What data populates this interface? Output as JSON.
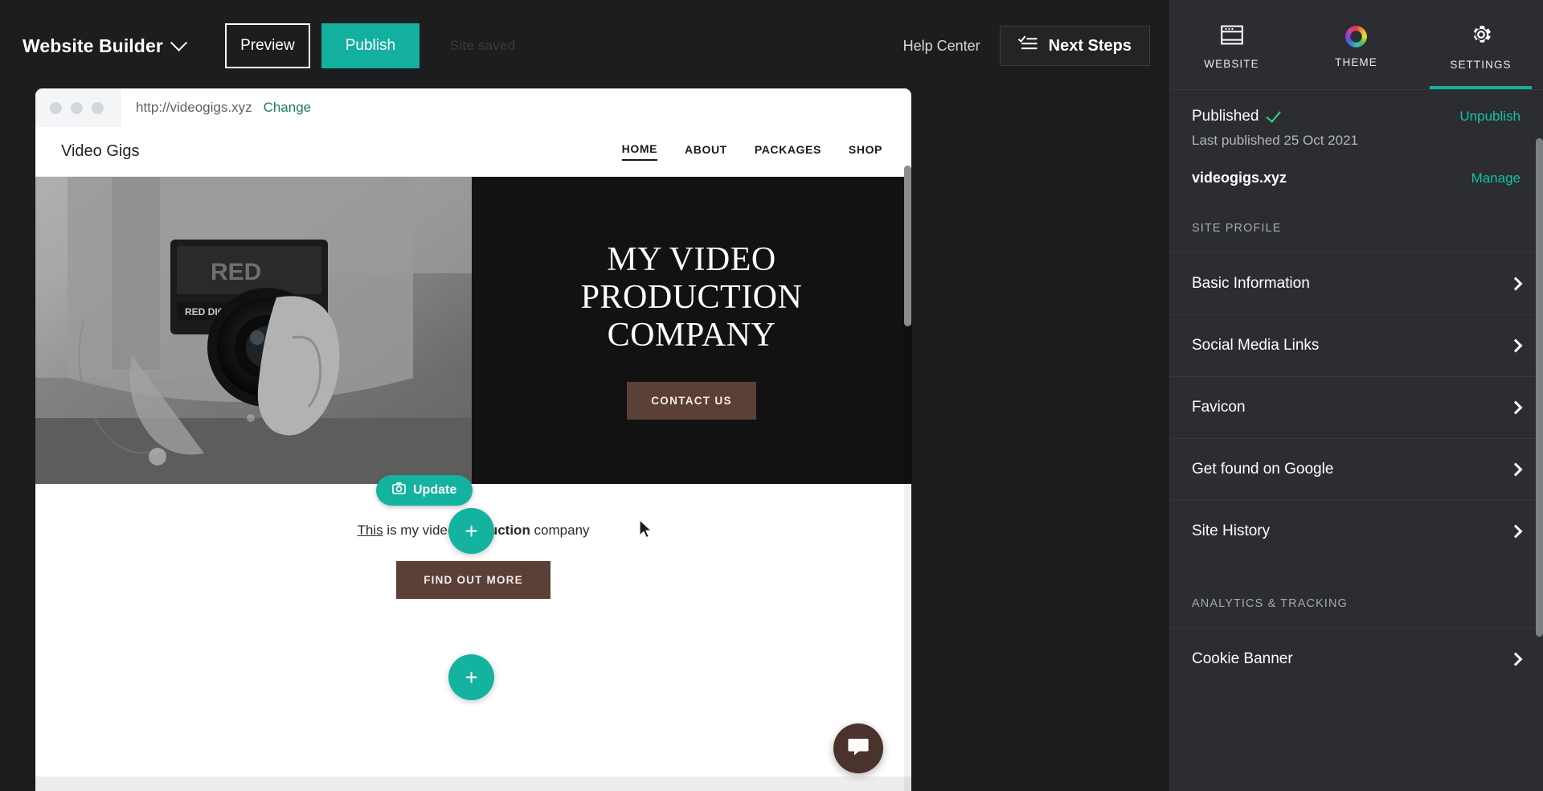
{
  "topbar": {
    "brand": "Website Builder",
    "brand_caret_icon": "chevron-down-icon",
    "preview_label": "Preview",
    "publish_label": "Publish",
    "ghost_status": "Site saved",
    "help_label": "Help Center",
    "next_steps_label": "Next Steps",
    "next_steps_icon": "checklist-icon"
  },
  "preview": {
    "url": "http://videogigs.xyz",
    "change_label": "Change",
    "site": {
      "logo": "Video Gigs",
      "menu": [
        {
          "label": "HOME",
          "active": true
        },
        {
          "label": "ABOUT",
          "active": false
        },
        {
          "label": "PACKAGES",
          "active": false
        },
        {
          "label": "SHOP",
          "active": false
        }
      ],
      "hero_title_line1": "MY VIDEO",
      "hero_title_line2": "PRODUCTION",
      "hero_title_line3": "COMPANY",
      "hero_cta": "CONTACT US",
      "body_text_1": "This",
      "body_text_2": " is my video ",
      "body_text_3": "production",
      "body_text_4": " company",
      "body_cta": "FIND OUT MORE"
    },
    "editor": {
      "update_label": "Update",
      "update_icon": "camera-icon",
      "add_section_label": "+",
      "chat_icon": "chat-bubble-icon"
    }
  },
  "sidebar": {
    "tabs": [
      {
        "label": "WEBSITE",
        "icon": "browser-window-icon",
        "active": false
      },
      {
        "label": "THEME",
        "icon": "color-wheel-icon",
        "active": false
      },
      {
        "label": "SETTINGS",
        "icon": "gear-icon",
        "active": true
      }
    ],
    "published": {
      "status_label": "Published",
      "status_icon": "check-icon",
      "unpublish_label": "Unpublish",
      "last_published": "Last published 25 Oct 2021",
      "domain": "videogigs.xyz",
      "manage_label": "Manage"
    },
    "sections": [
      {
        "heading": "SITE PROFILE",
        "items": [
          {
            "label": "Basic Information"
          },
          {
            "label": "Social Media Links"
          },
          {
            "label": "Favicon"
          },
          {
            "label": "Get found on Google"
          },
          {
            "label": "Site History"
          }
        ]
      },
      {
        "heading": "ANALYTICS & TRACKING",
        "items": [
          {
            "label": "Cookie Banner"
          }
        ]
      }
    ]
  },
  "colors": {
    "accent_teal": "#13b0a0",
    "brand_brown": "#5b4038",
    "dark_bg": "#1c1d1f",
    "sidebar_bg": "#2b2d30",
    "check_green": "#3ecf8e"
  }
}
